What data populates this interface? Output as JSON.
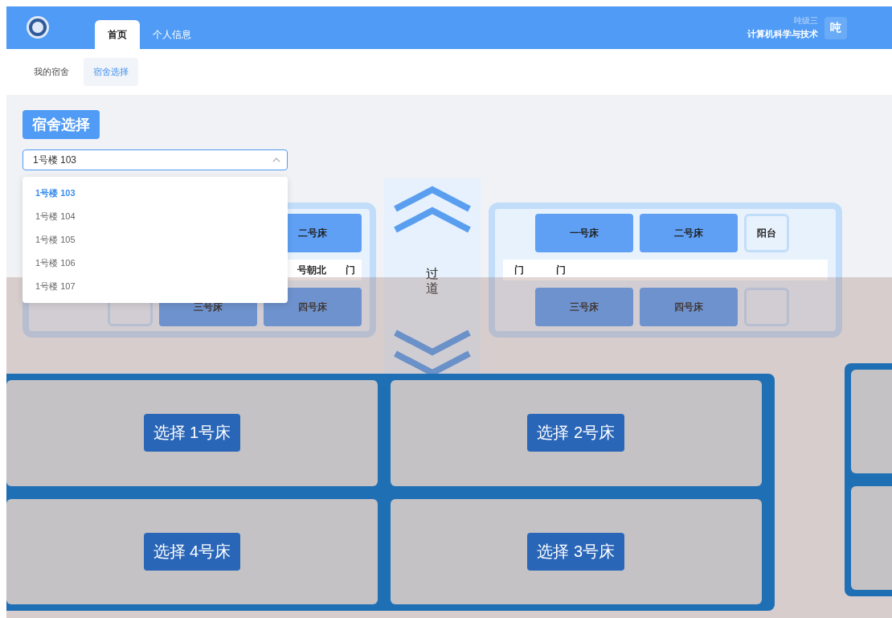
{
  "header": {
    "tabs": [
      {
        "label": "首页",
        "selected": true
      },
      {
        "label": "个人信息",
        "selected": false
      }
    ],
    "user": {
      "name": "吨级三",
      "major": "计算机科学与技术",
      "avatar": "吨"
    }
  },
  "subnav": [
    {
      "label": "我的宿舍",
      "selected": false
    },
    {
      "label": "宿舍选择",
      "selected": true
    }
  ],
  "section_title": "宿舍选择",
  "room_select": {
    "value": "1号楼 103",
    "expanded": true,
    "options": [
      {
        "label": "1号楼 103",
        "selected": true
      },
      {
        "label": "1号楼 104",
        "selected": false
      },
      {
        "label": "1号楼 105",
        "selected": false
      },
      {
        "label": "1号楼 106",
        "selected": false
      },
      {
        "label": "1号楼 107",
        "selected": false
      }
    ]
  },
  "layout": {
    "rooms": [
      {
        "kind": "balcony-left",
        "top_beds": [
          {
            "label": "二号床"
          }
        ],
        "bottom_beds": [
          {
            "label": "三号床"
          },
          {
            "label": "四号床"
          }
        ],
        "notes": [
          "号朝北",
          "门"
        ]
      },
      {
        "kind": "balcony-right",
        "top_beds": [
          {
            "label": "一号床"
          },
          {
            "label": "二号床"
          }
        ],
        "bottom_beds": [
          {
            "label": "三号床"
          },
          {
            "label": "四号床"
          }
        ],
        "notes": [
          "门",
          "门"
        ],
        "side_label": "阳台"
      }
    ],
    "corridor": "过道"
  },
  "bed_dialog": {
    "buttons": [
      {
        "label": "选择 1号床"
      },
      {
        "label": "选择 2号床"
      },
      {
        "label": "选择 4号床"
      },
      {
        "label": "选择 3号床"
      }
    ]
  }
}
